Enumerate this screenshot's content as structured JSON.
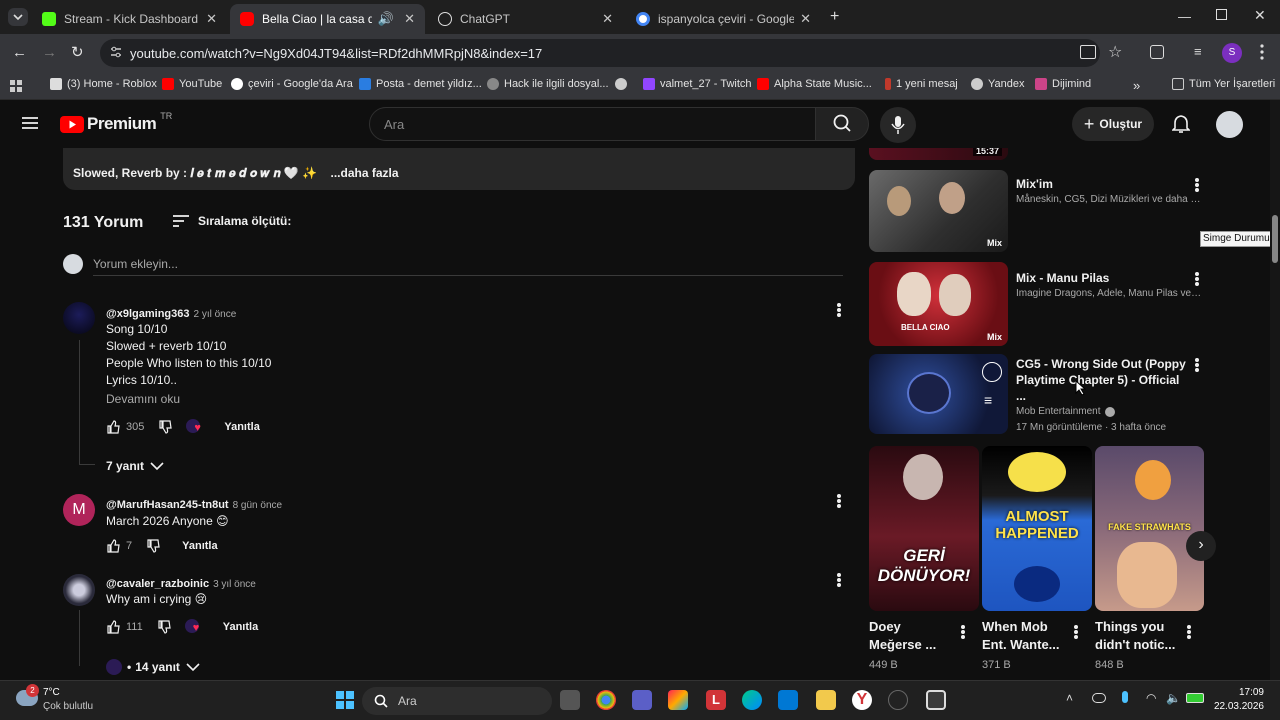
{
  "browser": {
    "tabs": [
      {
        "title": "Stream - Kick Dashboard",
        "color": "#53fc18"
      },
      {
        "title": "Bella Ciao | la casa de papel",
        "color": "#ff0000"
      },
      {
        "title": "ChatGPT",
        "color": "#ffffff"
      },
      {
        "title": "ispanyolca çeviri - Google'da Ar",
        "color": "#4285f4"
      }
    ],
    "url": "youtube.com/watch?v=Ng9Xd04JT94&list=RDf2dhMMRpjN8&index=17",
    "profile_letter": "S",
    "bookmarks": [
      "(3) Home - Roblox",
      "YouTube",
      "çeviri - Google'da Ara",
      "Posta - demet yildız...",
      "Hack ile ilgili dosyal...",
      "valmet_27 - Twitch",
      "Alpha State Music...",
      "1 yeni mesaj",
      "Yandex",
      "Dijimind"
    ],
    "all_bookmarks": "Tüm Yer İşaretleri"
  },
  "youtube": {
    "logo": "Premium",
    "region": "TR",
    "search_placeholder": "Ara",
    "create_label": "Oluştur"
  },
  "description": {
    "text": "Slowed, Reverb by : 𝒍 𝒆 𝒕 𝒎 𝒆 𝒅 𝒐 𝒘 𝒏 🤍 ✨",
    "more": "...daha fazla"
  },
  "comments_header": {
    "count": "131 Yorum",
    "sort": "Sıralama ölçütü:",
    "add_placeholder": "Yorum ekleyin..."
  },
  "comments": [
    {
      "handle": "@x9lgaming363",
      "ago": "2 yıl önce",
      "lines": [
        "Song 10/10",
        "Slowed + reverb 10/10",
        "People Who listen to this 10/10",
        "Lyrics 10/10.."
      ],
      "read_more": "Devamını oku",
      "likes": "305",
      "reply": "Yanıtla",
      "replies": "7 yanıt"
    },
    {
      "handle": "@MarufHasan245-tn8ut",
      "ago": "8 gün önce",
      "avatar_letter": "M",
      "lines": [
        "March 2026 Anyone 😊"
      ],
      "likes": "7",
      "reply": "Yanıtla"
    },
    {
      "handle": "@cavaler_razboinic",
      "ago": "3 yıl önce",
      "lines": [
        "Why am i crying 😢"
      ],
      "likes": "111",
      "reply": "Yanıtla",
      "replies": "14 yanıt"
    }
  ],
  "related": [
    {
      "title": "Mix'im",
      "sub": "Måneskin, CG5, Dizi Müzikleri ve daha fa...",
      "badge": "Mix"
    },
    {
      "title": "Mix - Manu Pilas",
      "sub": "Imagine Dragons, Adele, Manu Pilas ve d...",
      "badge": "Mix",
      "thumb_text": "BELLA CIAO"
    },
    {
      "title": "CG5 - Wrong Side Out (Poppy Playtime Chapter 5) - Official ...",
      "channel": "Mob Entertainment",
      "meta": "17 Mn görüntüleme · 3 hafta önce"
    }
  ],
  "top_partial_time": "15:37",
  "tooltip": "Simge Durumuna",
  "shorts": [
    {
      "title": "Doey Meğerse ...",
      "views": "449 B",
      "thumb_text": "GERİ DÖNÜYOR!"
    },
    {
      "title": "When Mob Ent. Wante...",
      "views": "371 B",
      "thumb_text": "ALMOST HAPPENED"
    },
    {
      "title": "Things you didn't notic...",
      "views": "848 B",
      "thumb_text": "FAKE STRAWHATS"
    }
  ],
  "taskbar": {
    "weather_temp": "7°C",
    "weather_desc": "Çok bulutlu",
    "search": "Ara",
    "time": "17:09",
    "date": "22.03.2026",
    "notif_count": "2"
  }
}
